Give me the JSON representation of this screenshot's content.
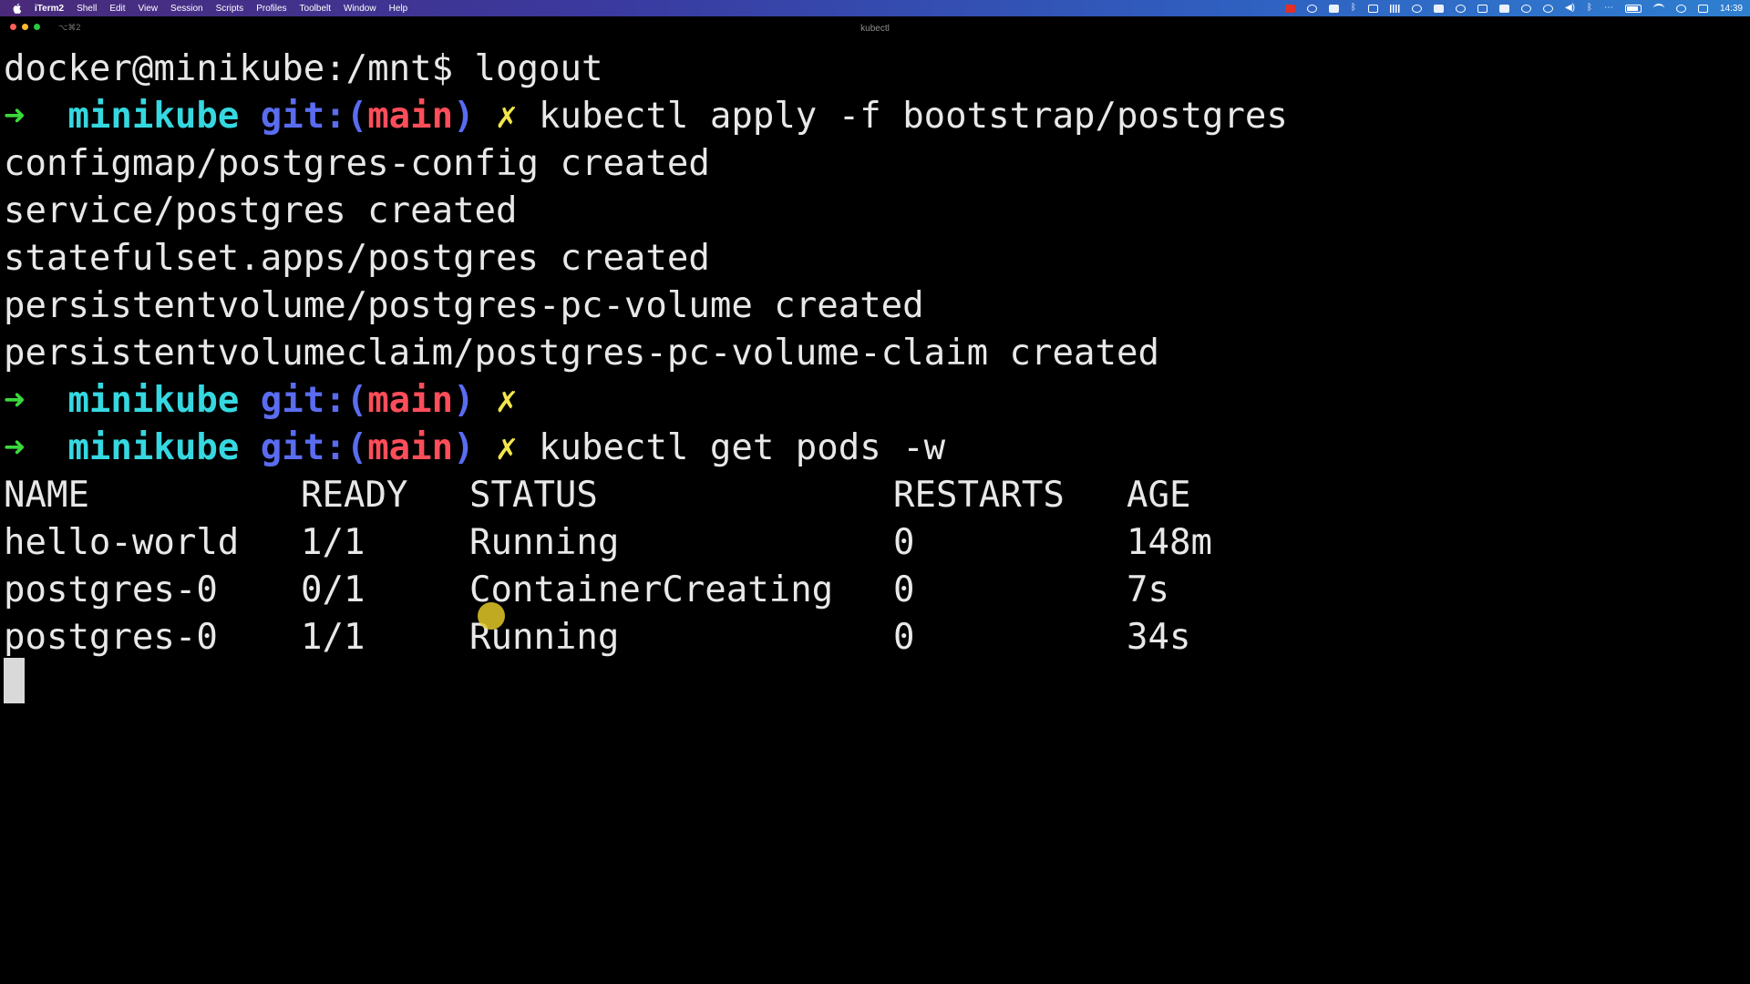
{
  "menubar": {
    "apple_icon": "apple-logo-icon",
    "app_name": "iTerm2",
    "menus": [
      "Shell",
      "Edit",
      "View",
      "Session",
      "Scripts",
      "Profiles",
      "Toolbelt",
      "Window",
      "Help"
    ],
    "clock": "14:39"
  },
  "window": {
    "tab_shortcut": "⌥⌘2",
    "title": "kubectl"
  },
  "terminal": {
    "line_logout": "docker@minikube:/mnt$ logout",
    "prompt": {
      "arrow": "➜",
      "host": "minikube",
      "git_open": "git:(",
      "branch": "main",
      "git_close": ")",
      "dirty": "✗"
    },
    "cmd_apply": "kubectl apply -f bootstrap/postgres",
    "apply_output": [
      "configmap/postgres-config created",
      "service/postgres created",
      "statefulset.apps/postgres created",
      "persistentvolume/postgres-pc-volume created",
      "persistentvolumeclaim/postgres-pc-volume-claim created"
    ],
    "cmd_get_pods": "kubectl get pods -w",
    "pods_table": {
      "headers": [
        "NAME",
        "READY",
        "STATUS",
        "RESTARTS",
        "AGE"
      ],
      "rows": [
        [
          "hello-world",
          "1/1",
          "Running",
          "0",
          "148m"
        ],
        [
          "postgres-0",
          "0/1",
          "ContainerCreating",
          "0",
          "7s"
        ],
        [
          "postgres-0",
          "1/1",
          "Running",
          "0",
          "34s"
        ]
      ]
    }
  },
  "colors": {
    "arrow": "#3bd93b",
    "host": "#35d8e0",
    "git": "#5a6cf0",
    "branch": "#ff4d5a",
    "dirty": "#f2e64a",
    "background": "#000000"
  }
}
